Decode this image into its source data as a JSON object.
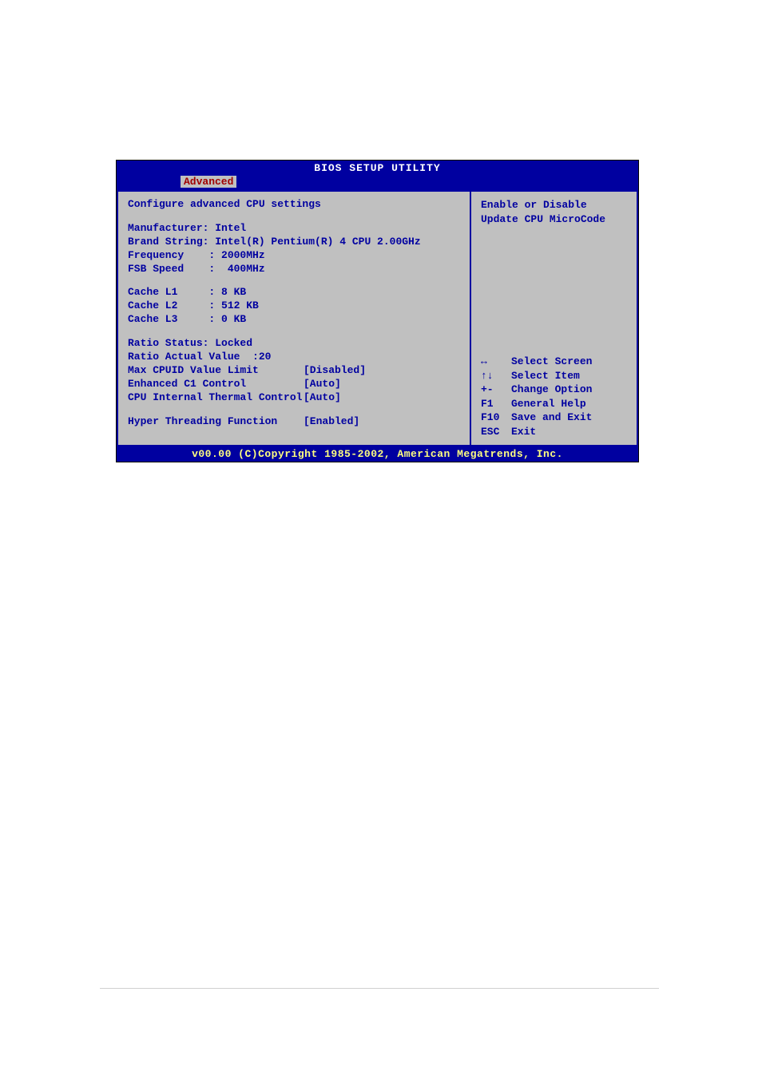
{
  "title": "BIOS SETUP UTILITY",
  "tab": "Advanced",
  "header": "Configure advanced CPU settings",
  "info": {
    "manufacturer_label": "Manufacturer: Intel",
    "brand_label": "Brand String: Intel(R) Pentium(R) 4 CPU 2.00GHz",
    "frequency_label": "Frequency    : 2000MHz",
    "fsb_label": "FSB Speed    :  400MHz",
    "cache_l1": "Cache L1     : 8 KB",
    "cache_l2": "Cache L2     : 512 KB",
    "cache_l3": "Cache L3     : 0 KB",
    "ratio_status": "Ratio Status: Locked",
    "ratio_actual": "Ratio Actual Value  :20"
  },
  "settings": [
    {
      "label": "Max CPUID Value Limit",
      "value": "[Disabled]"
    },
    {
      "label": "Enhanced C1 Control",
      "value": "[Auto]"
    },
    {
      "label": "CPU Internal Thermal Control",
      "value": "[Auto]"
    }
  ],
  "settings2": [
    {
      "label": "Hyper Threading Function",
      "value": "[Enabled]"
    }
  ],
  "help": {
    "line1": "Enable or Disable",
    "line2": "Update CPU MicroCode"
  },
  "nav": [
    {
      "key": "↔",
      "desc": "Select Screen"
    },
    {
      "key": "↑↓",
      "desc": "Select Item"
    },
    {
      "key": "+-",
      "desc": "Change Option"
    },
    {
      "key": "F1",
      "desc": "General Help"
    },
    {
      "key": "F10",
      "desc": "Save and Exit"
    },
    {
      "key": "ESC",
      "desc": "Exit"
    }
  ],
  "footer": "v00.00 (C)Copyright 1985-2002, American Megatrends, Inc."
}
